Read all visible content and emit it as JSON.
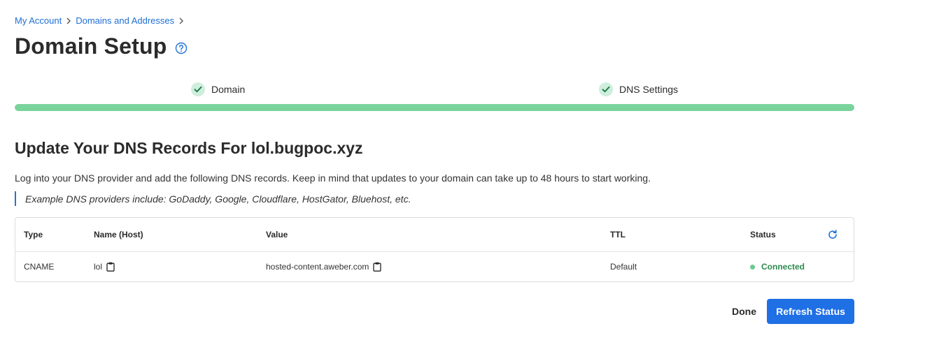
{
  "breadcrumb": [
    "My Account",
    "Domains and Addresses"
  ],
  "page": {
    "title": "Domain Setup"
  },
  "steps": [
    {
      "label": "Domain",
      "status": "complete"
    },
    {
      "label": "DNS Settings",
      "status": "complete"
    }
  ],
  "progress": {
    "percent": 100,
    "color": "#79d39b"
  },
  "section": {
    "title": "Update Your DNS Records For lol.bugpoc.xyz",
    "description": "Log into your DNS provider and add the following DNS records. Keep in mind that updates to your domain can take up to 48 hours to start working.",
    "example": "Example DNS providers include: GoDaddy, Google, Cloudflare, HostGator, Bluehost, etc."
  },
  "table": {
    "columns": [
      "Type",
      "Name (Host)",
      "Value",
      "TTL",
      "Status"
    ],
    "rows": [
      {
        "type": "CNAME",
        "name": "lol",
        "value": "hosted-content.aweber.com",
        "ttl": "Default",
        "status": "Connected"
      }
    ]
  },
  "actions": {
    "done": "Done",
    "refresh": "Refresh Status"
  },
  "colors": {
    "accent": "#1f6fe5",
    "success": "#6cc990",
    "link": "#1f6fd6"
  },
  "icons": [
    "chevron-right-icon",
    "help-circle-icon",
    "check-icon",
    "refresh-icon",
    "clipboard-icon"
  ]
}
